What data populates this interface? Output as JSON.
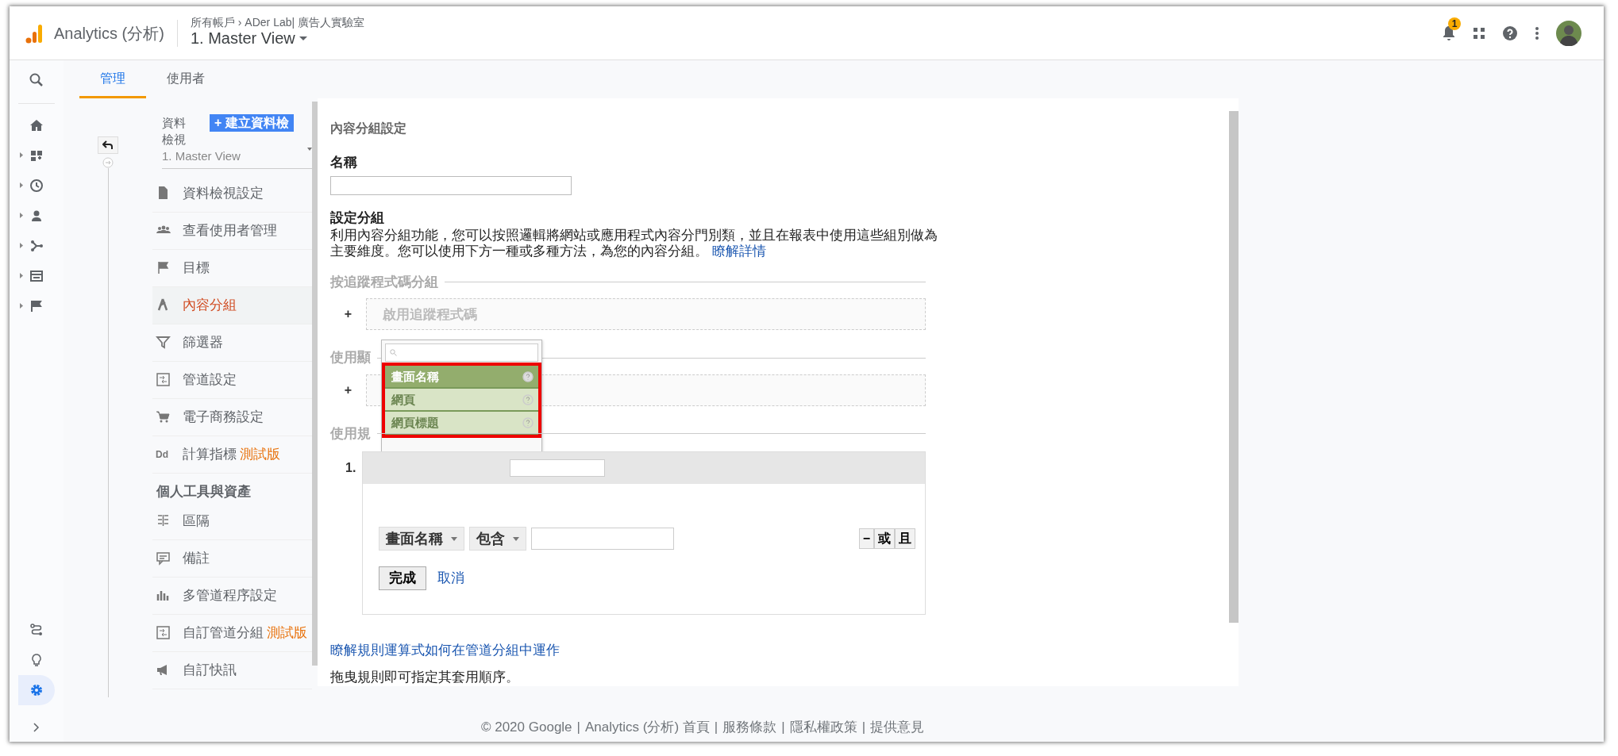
{
  "header": {
    "product": "Analytics (分析)",
    "breadcrumb": "所有帳戶 › ADer Lab| 廣告人實驗室",
    "view": "1. Master View",
    "notification_count": "1"
  },
  "tabs": [
    {
      "label": "管理",
      "selected": true
    },
    {
      "label": "使用者",
      "selected": false
    }
  ],
  "rail": {
    "items": [
      {
        "expandable": false,
        "selected": false
      },
      {
        "expandable": true,
        "selected": false
      },
      {
        "expandable": true,
        "selected": false
      },
      {
        "expandable": true,
        "selected": false
      },
      {
        "expandable": true,
        "selected": false
      },
      {
        "expandable": true,
        "selected": false
      },
      {
        "expandable": true,
        "selected": false
      }
    ],
    "bottom_items": [
      {
        "selected": false
      },
      {
        "selected": false
      },
      {
        "selected": true
      }
    ]
  },
  "sidebar": {
    "label": "資料檢視",
    "create_plus": "+",
    "create_button": "建立資料檢",
    "view_select": "1. Master View",
    "items": [
      {
        "kind": "item",
        "label": "資料檢視設定",
        "selected": false
      },
      {
        "kind": "item",
        "label": "查看使用者管理",
        "selected": false
      },
      {
        "kind": "item",
        "label": "目標",
        "selected": false
      },
      {
        "kind": "item",
        "label": "內容分組",
        "selected": true
      },
      {
        "kind": "item",
        "label": "篩選器",
        "selected": false
      },
      {
        "kind": "item",
        "label": "管道設定",
        "selected": false
      },
      {
        "kind": "item",
        "label": "電子商務設定",
        "selected": false
      },
      {
        "kind": "item",
        "label": "計算指標",
        "icon_text": "Dd",
        "badge": "測試版",
        "selected": false
      },
      {
        "kind": "heading",
        "label": "個人工具與資產"
      },
      {
        "kind": "item",
        "label": "區隔",
        "selected": false
      },
      {
        "kind": "item",
        "label": "備註",
        "selected": false
      },
      {
        "kind": "item",
        "label": "多管道程序設定",
        "selected": false
      },
      {
        "kind": "item",
        "label": "自訂管道分組",
        "badge": "測試版",
        "selected": false
      },
      {
        "kind": "item",
        "label": "自訂快訊",
        "selected": false
      }
    ]
  },
  "main": {
    "title": "內容分組設定",
    "name_label": "名稱",
    "group_label": "設定分組",
    "description": "利用內容分組功能，您可以按照邏輯將網站或應用程式內容分門別類，並且在報表中使用這些組別做為主要維度。您可以使用下方一種或多種方法，為您的內容分組。",
    "description_link": "瞭解詳情",
    "sections": [
      {
        "kind": "tracking",
        "title": "按追蹤程式碼分組",
        "plus": "+",
        "box_text": "啟用追蹤程式碼"
      },
      {
        "kind": "extraction",
        "title": "使用顯",
        "plus": "+"
      },
      {
        "kind": "rules",
        "title": "使用規",
        "rule": {
          "number": "1.",
          "dimension": "畫面名稱",
          "operator": "包含",
          "buttons": [
            "−",
            "或",
            "且"
          ],
          "done": "完成",
          "cancel": "取消"
        }
      }
    ],
    "dropdown": {
      "highlighted": true,
      "items": [
        {
          "label": "畫面名稱",
          "selected": true
        },
        {
          "label": "網頁",
          "selected": false
        },
        {
          "label": "網頁標題",
          "selected": false
        }
      ]
    },
    "help_link": "瞭解規則運算式如何在管道分組中運作",
    "drag_hint": "拖曳規則即可指定其套用順序。"
  },
  "footer": {
    "copyright": "© 2020 Google",
    "separator": "|",
    "links": [
      "Analytics (分析) 首頁",
      "服務條款",
      "隱私權政策",
      "提供意見"
    ]
  }
}
